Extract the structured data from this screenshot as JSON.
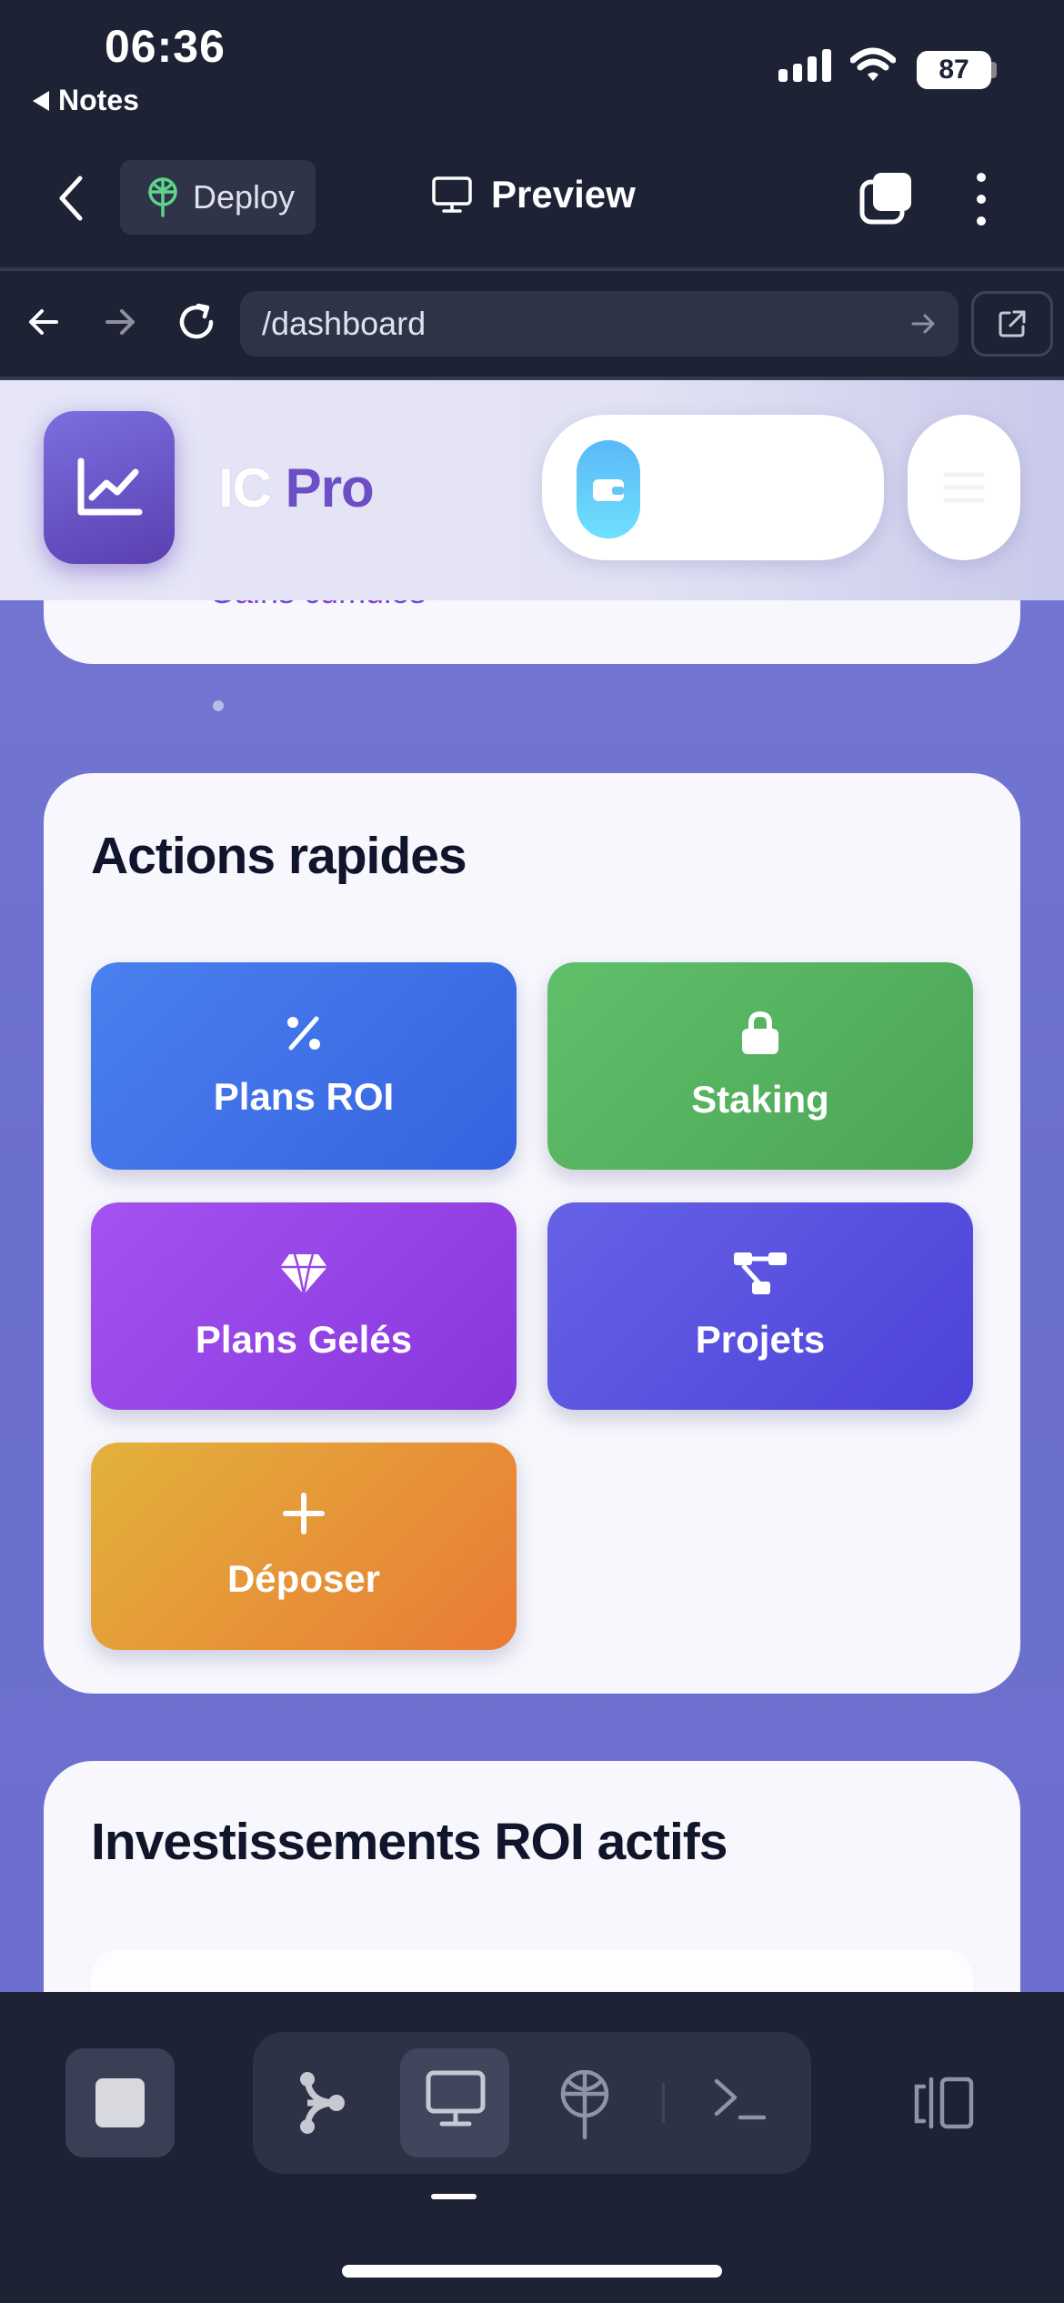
{
  "status_bar": {
    "time": "06:36",
    "back_label": "Notes",
    "battery": "87"
  },
  "header": {
    "deploy_label": "Deploy",
    "preview_label": "Preview"
  },
  "browser": {
    "url": "/dashboard"
  },
  "app": {
    "brand_part1": "IC ",
    "brand_part2": "Pro",
    "previous_card_text": "Gains cumulés"
  },
  "quick_actions": {
    "title": "Actions rapides",
    "items": [
      {
        "label": "Plans ROI",
        "icon": "percent-icon",
        "color": "#3f6fe8"
      },
      {
        "label": "Staking",
        "icon": "lock-icon",
        "color": "#56b160"
      },
      {
        "label": "Plans Gelés",
        "icon": "gem-icon",
        "color": "#9845e6"
      },
      {
        "label": "Projets",
        "icon": "project-diagram-icon",
        "color": "#5852e0"
      },
      {
        "label": "Déposer",
        "icon": "plus-icon",
        "color": "#e6963a"
      }
    ]
  },
  "roi_section": {
    "title": "Investissements ROI actifs"
  },
  "colors": {
    "background": "#1e2235",
    "web_background": "#7072cf",
    "brand_accent": "#6c4fc4"
  }
}
